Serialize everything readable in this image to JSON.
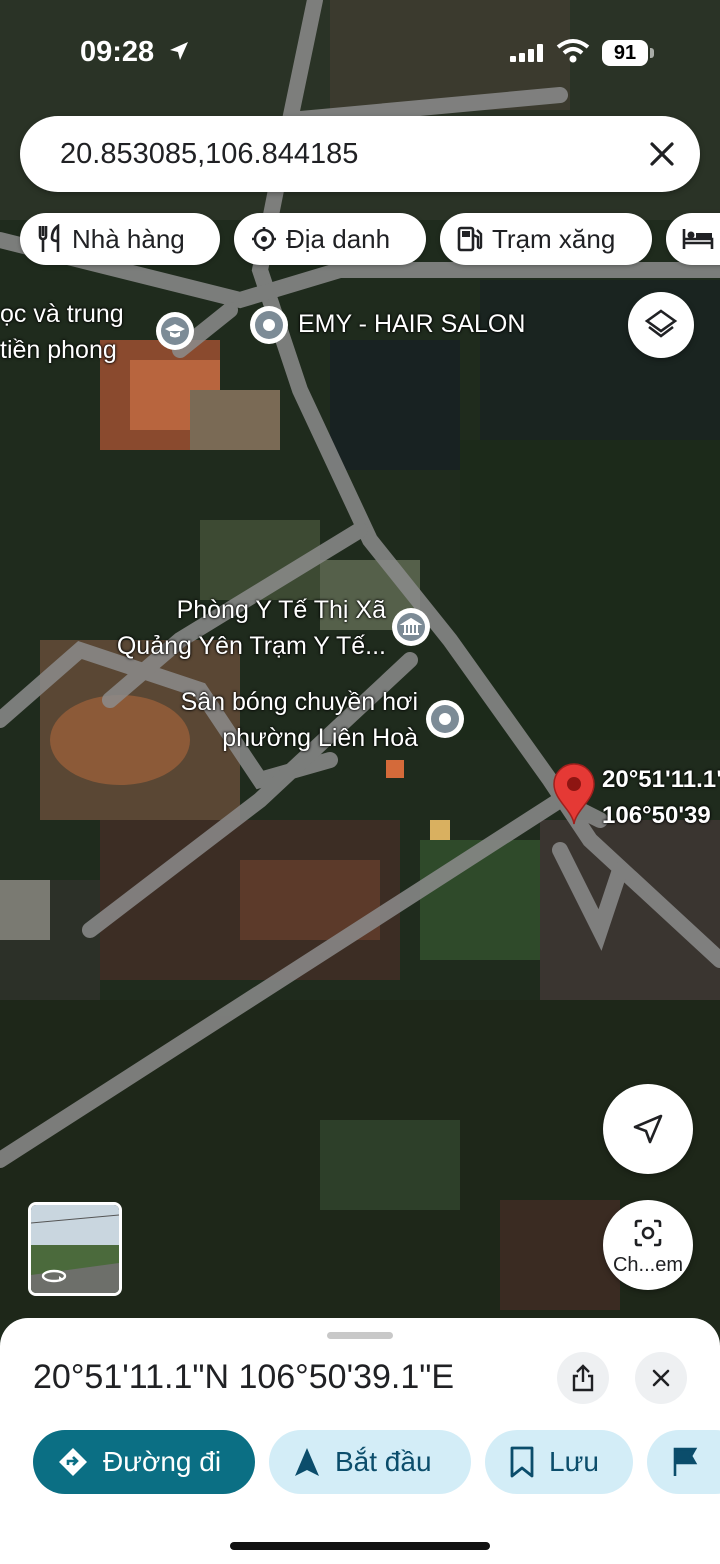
{
  "status_bar": {
    "time": "09:28",
    "battery": "91"
  },
  "search": {
    "query": "20.853085,106.844185"
  },
  "chips": [
    {
      "label": "Nhà hàng",
      "icon": "fork-knife-icon"
    },
    {
      "label": "Địa danh",
      "icon": "landmark-icon"
    },
    {
      "label": "Trạm xăng",
      "icon": "gas-pump-icon"
    },
    {
      "label": "",
      "icon": "bed-icon"
    }
  ],
  "map": {
    "school_label_line1": "ọc và trung",
    "school_label_line2": "tiền phong",
    "salon_label": "EMY - HAIR SALON",
    "clinic_label_line1": "Phòng Y Tế Thị Xã",
    "clinic_label_line2": "Quảng Yên Trạm Y Tế...",
    "court_label_line1": "Sân bóng chuyền hơi",
    "court_label_line2": "phường Liên Hoà",
    "pin_label_line1": "20°51'11.1\"",
    "pin_label_line2": "106°50'39"
  },
  "controls": {
    "lens_label": "Ch...em"
  },
  "sheet": {
    "title": "20°51'11.1\"N 106°50'39.1\"E",
    "buttons": {
      "directions": "Đường đi",
      "start": "Bắt đầu",
      "save": "Lưu"
    }
  },
  "colors": {
    "primary": "#0b6f84",
    "tonal": "#d3edf7",
    "pin": "#e53935"
  }
}
